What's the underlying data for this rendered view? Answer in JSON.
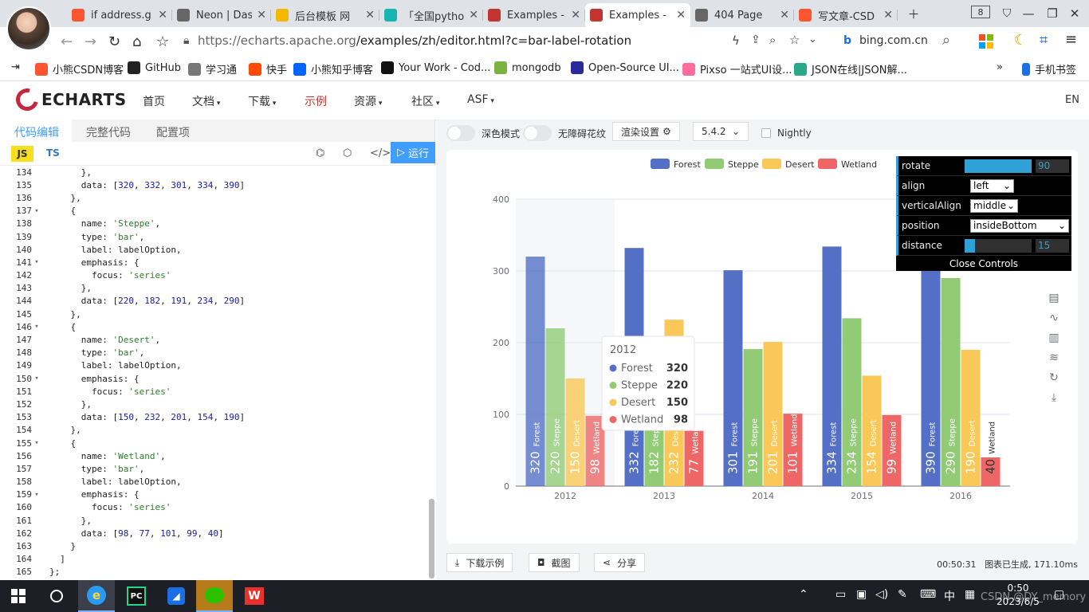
{
  "browser": {
    "tabs": [
      {
        "label": "if address.g",
        "color": "#fc5531"
      },
      {
        "label": "Neon | Dash",
        "color": "#666666"
      },
      {
        "label": "后台模板 网",
        "color": "#f5b800"
      },
      {
        "label": "「全国pytho",
        "color": "#18b4b4"
      },
      {
        "label": "Examples -",
        "color": "#c23531"
      },
      {
        "label": "Examples -",
        "color": "#c23531",
        "active": true
      },
      {
        "label": "404 Page",
        "color": "#666666"
      },
      {
        "label": "写文章-CSD",
        "color": "#fc5531"
      }
    ],
    "tab_count": "8",
    "url_host": "https://echarts.apache.org",
    "url_path": "/examples/zh/editor.html?c=bar-label-rotation",
    "search_engine": "bing.com.cn",
    "bookmarks": [
      {
        "label": "小熊CSDN博客",
        "color": "#fc5531"
      },
      {
        "label": "GitHub",
        "color": "#222222"
      },
      {
        "label": "学习通",
        "color": "#777777"
      },
      {
        "label": "快手",
        "color": "#ff4906"
      },
      {
        "label": "小熊知乎博客",
        "color": "#0066ff"
      },
      {
        "label": "Your Work - Cod...",
        "color": "#111111"
      },
      {
        "label": "mongodb",
        "color": "#7bb341"
      },
      {
        "label": "Open-Source UI...",
        "color": "#2a2a9a"
      },
      {
        "label": "Pixso 一站式UI设...",
        "color": "#ff6b9a"
      },
      {
        "label": "JSON在线|JSON解...",
        "color": "#2aa88a"
      }
    ],
    "mobile_bookmarks": "手机书签"
  },
  "site": {
    "logo": "ECHARTS",
    "menu": [
      "首页",
      "文档",
      "下载",
      "示例",
      "资源",
      "社区",
      "ASF"
    ],
    "lang": "EN"
  },
  "editor": {
    "tabs": [
      "代码编辑",
      "完整代码",
      "配置项"
    ],
    "js": "JS",
    "ts": "TS",
    "run": "运行",
    "lines": [
      {
        "n": "134",
        "c": "      },"
      },
      {
        "n": "135",
        "c": "      data: [320, 332, 301, 334, 390]"
      },
      {
        "n": "136",
        "c": "    },"
      },
      {
        "n": "137",
        "c": "    {",
        "fold": true
      },
      {
        "n": "138",
        "c": "      name: 'Steppe',"
      },
      {
        "n": "139",
        "c": "      type: 'bar',"
      },
      {
        "n": "140",
        "c": "      label: labelOption,"
      },
      {
        "n": "141",
        "c": "      emphasis: {",
        "fold": true
      },
      {
        "n": "142",
        "c": "        focus: 'series'"
      },
      {
        "n": "143",
        "c": "      },"
      },
      {
        "n": "144",
        "c": "      data: [220, 182, 191, 234, 290]"
      },
      {
        "n": "145",
        "c": "    },"
      },
      {
        "n": "146",
        "c": "    {",
        "fold": true
      },
      {
        "n": "147",
        "c": "      name: 'Desert',"
      },
      {
        "n": "148",
        "c": "      type: 'bar',"
      },
      {
        "n": "149",
        "c": "      label: labelOption,"
      },
      {
        "n": "150",
        "c": "      emphasis: {",
        "fold": true
      },
      {
        "n": "151",
        "c": "        focus: 'series'"
      },
      {
        "n": "152",
        "c": "      },"
      },
      {
        "n": "153",
        "c": "      data: [150, 232, 201, 154, 190]"
      },
      {
        "n": "154",
        "c": "    },"
      },
      {
        "n": "155",
        "c": "    {",
        "fold": true
      },
      {
        "n": "156",
        "c": "      name: 'Wetland',"
      },
      {
        "n": "157",
        "c": "      type: 'bar',"
      },
      {
        "n": "158",
        "c": "      label: labelOption,"
      },
      {
        "n": "159",
        "c": "      emphasis: {",
        "fold": true
      },
      {
        "n": "160",
        "c": "        focus: 'series'"
      },
      {
        "n": "161",
        "c": "      },"
      },
      {
        "n": "162",
        "c": "      data: [98, 77, 101, 99, 40]"
      },
      {
        "n": "163",
        "c": "    }"
      },
      {
        "n": "164",
        "c": "  ]"
      },
      {
        "n": "165",
        "c": "};"
      }
    ]
  },
  "preview": {
    "dark_mode": "深色模式",
    "no_decal": "无障碍花纹",
    "render_settings": "渲染设置",
    "version": "5.4.2",
    "nightly": "Nightly",
    "download": "下载示例",
    "screenshot": "截图",
    "share": "分享",
    "time": "00:50:31",
    "status": "图表已生成, 171.10ms"
  },
  "controls": {
    "rotate_label": "rotate",
    "rotate_value": "90",
    "rotate_fraction": 1.0,
    "align_label": "align",
    "align_value": "left",
    "valign_label": "verticalAlign",
    "valign_value": "middle",
    "position_label": "position",
    "position_value": "insideBottom",
    "distance_label": "distance",
    "distance_value": "15",
    "distance_fraction": 0.15,
    "close": "Close Controls"
  },
  "chart_data": {
    "type": "bar",
    "categories": [
      "2012",
      "2013",
      "2014",
      "2015",
      "2016"
    ],
    "series": [
      {
        "name": "Forest",
        "color": "#5470c6",
        "values": [
          320,
          332,
          301,
          334,
          390
        ]
      },
      {
        "name": "Steppe",
        "color": "#91cc75",
        "values": [
          220,
          182,
          191,
          234,
          290
        ]
      },
      {
        "name": "Desert",
        "color": "#fac858",
        "values": [
          150,
          232,
          201,
          154,
          190
        ]
      },
      {
        "name": "Wetland",
        "color": "#ee6666",
        "values": [
          98,
          77,
          101,
          99,
          40
        ]
      }
    ],
    "yticks": [
      "0",
      "100",
      "200",
      "300",
      "400"
    ],
    "ylim": [
      0,
      400
    ],
    "legend": "top-center",
    "highlighted_category": "2012",
    "tooltip": {
      "title": "2012",
      "rows": [
        {
          "name": "Forest",
          "value": "320"
        },
        {
          "name": "Steppe",
          "value": "220"
        },
        {
          "name": "Desert",
          "value": "150"
        },
        {
          "name": "Wetland",
          "value": "98"
        }
      ]
    }
  },
  "taskbar": {
    "ime": "中",
    "time": "0:50",
    "date": "2023/6/5"
  },
  "watermark": "CSDN @DY_memory"
}
